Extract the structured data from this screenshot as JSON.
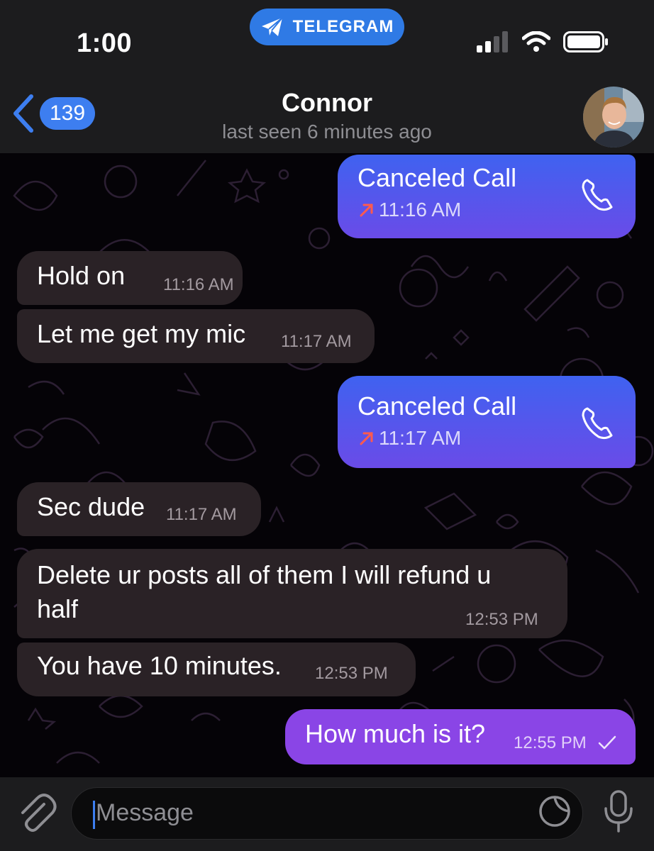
{
  "status_bar": {
    "time": "1:00",
    "telegram_pill": "TELEGRAM"
  },
  "header": {
    "unread_count": "139",
    "title": "Connor",
    "subtitle": "last seen 6 minutes ago"
  },
  "messages": [
    {
      "type": "call",
      "direction": "out",
      "title": "Canceled Call",
      "time": "11:16 AM"
    },
    {
      "type": "text",
      "direction": "in",
      "text": "Hold on",
      "time": "11:16 AM"
    },
    {
      "type": "text",
      "direction": "in",
      "text": "Let me get my mic",
      "time": "11:17 AM"
    },
    {
      "type": "call",
      "direction": "out",
      "title": "Canceled Call",
      "time": "11:17 AM"
    },
    {
      "type": "text",
      "direction": "in",
      "text": "Sec dude",
      "time": "11:17 AM"
    },
    {
      "type": "text",
      "direction": "in",
      "lines": [
        "Delete ur posts all of them I will refund u",
        "half"
      ],
      "time": "12:53 PM"
    },
    {
      "type": "text",
      "direction": "in",
      "text": "You have 10 minutes.",
      "time": "12:53 PM"
    },
    {
      "type": "text",
      "direction": "out",
      "text": "How much is it?",
      "time": "12:55 PM",
      "read_status": "sent-check"
    }
  ],
  "composer": {
    "placeholder": "Message"
  },
  "icons": {
    "back": "chevron-left-icon",
    "telegram": "paper-plane-icon",
    "signal": "signal-bars-icon",
    "wifi": "wifi-icon",
    "battery": "battery-icon",
    "phone": "phone-icon",
    "missed_arrow": "arrow-up-right-icon",
    "attach": "paperclip-icon",
    "sticker": "sticker-icon",
    "mic": "microphone-icon"
  },
  "colors": {
    "accent": "#3d7ef0",
    "incoming_bubble": "#2a2226",
    "outgoing_gradient_top": "#3f62f0",
    "outgoing_gradient_bottom": "#6a4be8",
    "outgoing_violet": "#8a45e6",
    "missed_call_red": "#ff5a4e"
  }
}
